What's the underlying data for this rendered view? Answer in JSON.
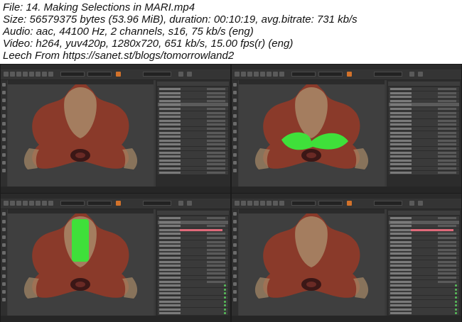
{
  "header": {
    "file": "File: 14. Making Selections in MARI.mp4",
    "size": "Size: 56579375 bytes (53.96 MiB), duration: 00:10:19, avg.bitrate: 731 kb/s",
    "audio": "Audio: aac, 44100 Hz, 2 channels, s16, 75 kb/s (eng)",
    "video": "Video: h264, yuv420p, 1280x720, 651 kb/s, 15.00 fps(r) (eng)",
    "leech": "Leech From https://sanet.st/blogs/tomorrowland2"
  },
  "colors": {
    "selection_green": "#3fe03a",
    "model_rust": "#8a3a2a",
    "model_bone": "#a88a68",
    "ui_dark": "#2c2c2c",
    "accent_orange": "#d2722a"
  },
  "panes": [
    {
      "id": "top-left",
      "selection": "none"
    },
    {
      "id": "top-right",
      "selection": "mouth-region"
    },
    {
      "id": "bottom-left",
      "selection": "head-strip"
    },
    {
      "id": "bottom-right",
      "selection": "none"
    }
  ]
}
